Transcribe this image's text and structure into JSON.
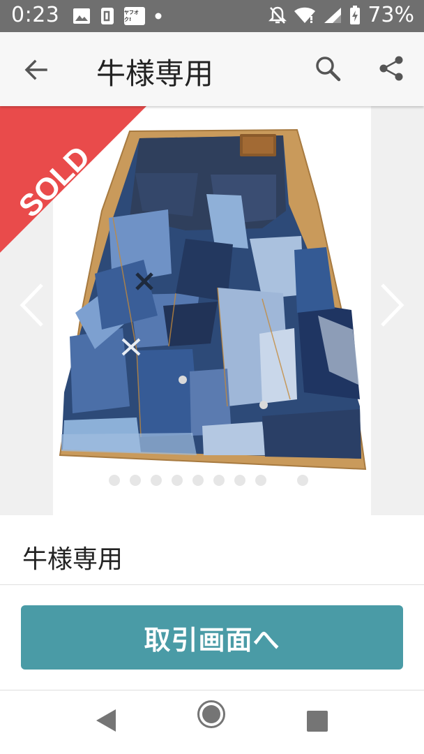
{
  "status_bar": {
    "time": "0:23",
    "battery_percent": "73%",
    "icons": [
      "image-icon",
      "nfc-icon",
      "yahoo-auction-icon",
      "notification-dot-icon",
      "bell-off-icon",
      "wifi-icon",
      "signal-icon",
      "battery-charging-icon"
    ],
    "yahoo_badge_text": "ヤフオク!"
  },
  "app_bar": {
    "title": "牛様専用",
    "icons": [
      "back-arrow-icon",
      "search-icon",
      "share-icon"
    ]
  },
  "gallery": {
    "badge": "SOLD",
    "badge_color": "#e94b4b",
    "slide_count": 10,
    "active_slide": 9,
    "photo_subject": "patchwork denim skirt"
  },
  "item": {
    "title": "牛様専用"
  },
  "cta": {
    "label": "取引画面へ",
    "color": "#4a9ba6"
  },
  "system_nav": {
    "icons": [
      "nav-back-icon",
      "nav-home-icon",
      "nav-recents-icon"
    ]
  }
}
